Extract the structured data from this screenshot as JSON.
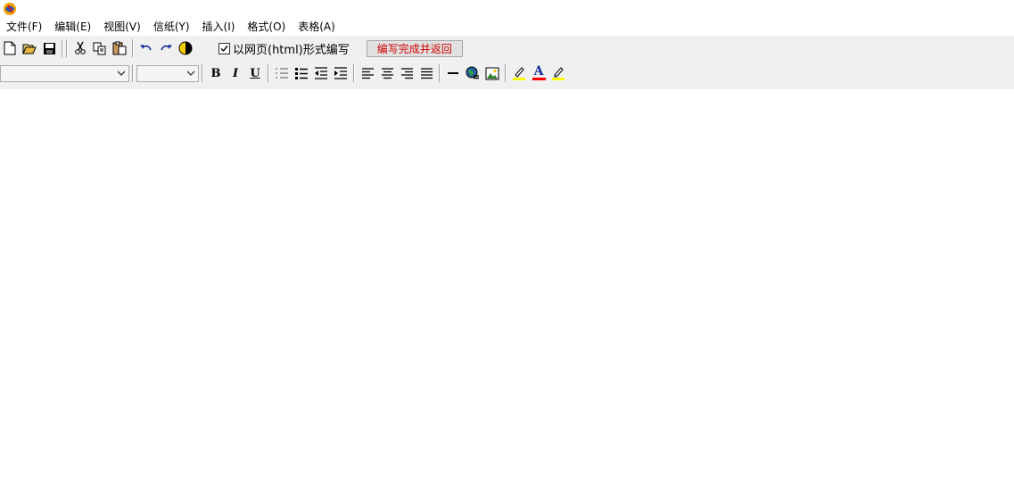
{
  "menu": {
    "items": [
      {
        "label": "文件(F)"
      },
      {
        "label": "编辑(E)"
      },
      {
        "label": "视图(V)"
      },
      {
        "label": "信纸(Y)"
      },
      {
        "label": "插入(I)"
      },
      {
        "label": "格式(O)"
      },
      {
        "label": "表格(A)"
      }
    ]
  },
  "toolbar": {
    "html_mode_label": "以网页(html)形式编写",
    "html_mode_checked": true,
    "done_button_label": "编写完成并返回",
    "font_family_value": "",
    "font_size_value": ""
  },
  "format": {
    "bold": "B",
    "italic": "I",
    "underline": "U",
    "font_color_glyph": "A"
  },
  "colors": {
    "toolbar_bg": "#f0f0f0",
    "done_text": "#d00000",
    "highlight_yellow": "#ffff00",
    "font_color_red": "#ff0000"
  }
}
